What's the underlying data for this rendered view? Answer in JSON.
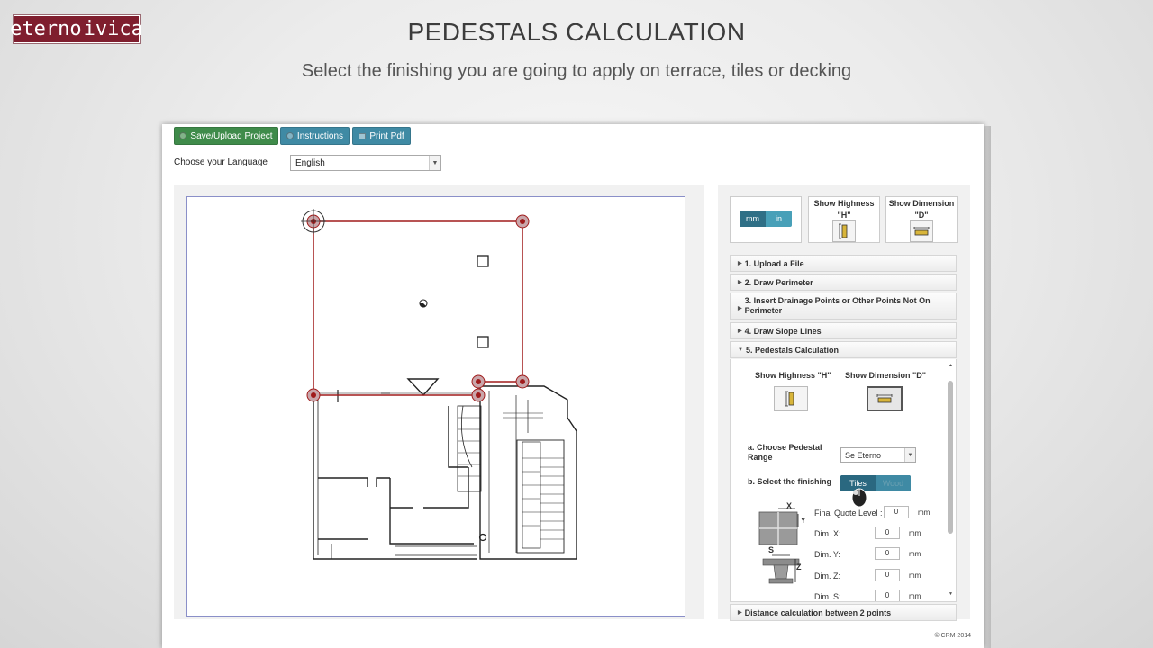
{
  "brand": {
    "logo_text_left": "eterno",
    "logo_text_right": "ivica"
  },
  "header": {
    "title": "PEDESTALS CALCULATION",
    "subtitle": "Select the finishing you are going to apply on terrace, tiles or decking"
  },
  "toolbar": {
    "save_label": "Save/Upload Project",
    "instructions_label": "Instructions",
    "print_label": "Print Pdf",
    "colors": {
      "save": "#3f8b4a",
      "instructions": "#3f8aa4",
      "print": "#3f8aa4"
    }
  },
  "language": {
    "label": "Choose your Language",
    "selected": "English"
  },
  "units": {
    "mm": "mm",
    "in": "in",
    "active": "mm"
  },
  "show_highness": {
    "line1": "Show Highness",
    "line2": "\"H\""
  },
  "show_dimension": {
    "line1": "Show Dimension",
    "line2": "\"D\""
  },
  "accordion": {
    "s1": "1. Upload a File",
    "s2": "2. Draw Perimeter",
    "s3a": "3. Insert Drainage Points or Other Points Not On",
    "s3b": "Perimeter",
    "s4": "4. Draw Slope Lines",
    "s5": "5. Pedestals Calculation",
    "distance": "Distance calculation between 2 points"
  },
  "panel5": {
    "show_h": "Show Highness \"H\"",
    "show_d": "Show Dimension \"D\"",
    "range_label_1": "a. Choose Pedestal",
    "range_label_2": "Range",
    "range_value": "Se Eterno",
    "finishing_label": "b. Select the finishing",
    "finishing_tiles": "Tiles",
    "finishing_wood": "Wood",
    "finishing_active": "Tiles",
    "diagram_x": "X",
    "diagram_y": "Y",
    "diagram_s": "S",
    "diagram_z": "Z",
    "fields": {
      "final_label": "Final Quote Level :",
      "final_value": "0",
      "dimx_label": "Dim. X:",
      "dimx_value": "0",
      "dimy_label": "Dim. Y:",
      "dimy_value": "0",
      "dimz_label": "Dim. Z:",
      "dimz_value": "0",
      "dims_label": "Dim. S:",
      "dims_value": "0",
      "unit": "mm"
    }
  },
  "footer": {
    "copyright": "© CRM 2014"
  }
}
